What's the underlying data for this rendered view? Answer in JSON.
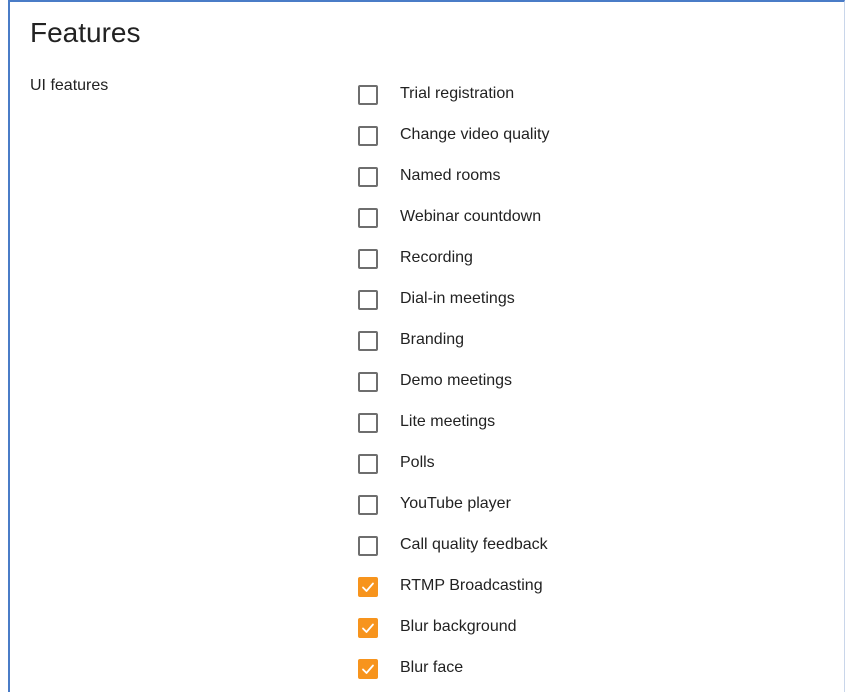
{
  "page": {
    "title": "Features"
  },
  "section": {
    "label": "UI features"
  },
  "colors": {
    "accent": "#f7941d",
    "frame_border": "#4a7cc7",
    "unchecked_border": "#6e6e6e",
    "text": "#222222"
  },
  "features": [
    {
      "label": "Trial registration",
      "checked": false
    },
    {
      "label": "Change video quality",
      "checked": false
    },
    {
      "label": "Named rooms",
      "checked": false
    },
    {
      "label": "Webinar countdown",
      "checked": false
    },
    {
      "label": "Recording",
      "checked": false
    },
    {
      "label": "Dial-in meetings",
      "checked": false
    },
    {
      "label": "Branding",
      "checked": false
    },
    {
      "label": "Demo meetings",
      "checked": false
    },
    {
      "label": "Lite meetings",
      "checked": false
    },
    {
      "label": "Polls",
      "checked": false
    },
    {
      "label": "YouTube player",
      "checked": false
    },
    {
      "label": "Call quality feedback",
      "checked": false
    },
    {
      "label": "RTMP Broadcasting",
      "checked": true
    },
    {
      "label": "Blur background",
      "checked": true
    },
    {
      "label": "Blur face",
      "checked": true
    }
  ]
}
